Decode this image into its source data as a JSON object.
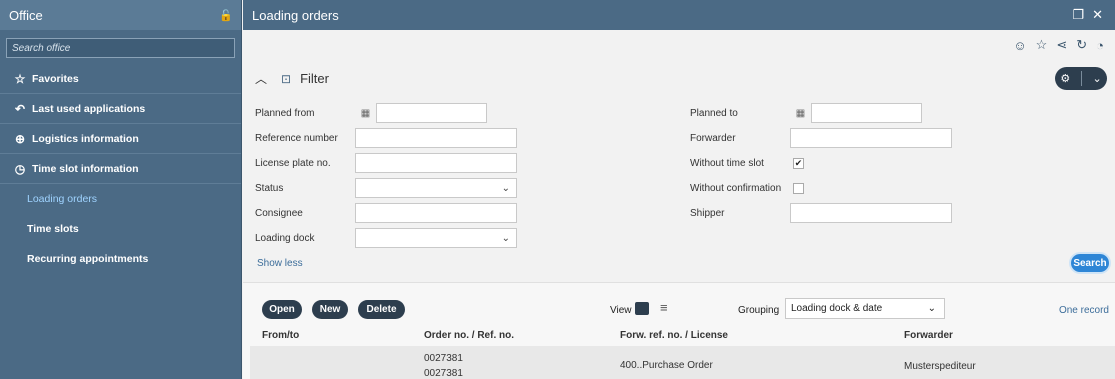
{
  "sidebar": {
    "title": "Office",
    "search_placeholder": "Search office",
    "items": [
      {
        "label": "Favorites"
      },
      {
        "label": "Last used applications"
      },
      {
        "label": "Logistics information"
      },
      {
        "label": "Time slot information"
      }
    ],
    "subitems": [
      {
        "label": "Loading orders",
        "active": true
      },
      {
        "label": "Time slots"
      },
      {
        "label": "Recurring appointments"
      }
    ]
  },
  "window": {
    "title": "Loading orders"
  },
  "filter": {
    "title": "Filter",
    "fields_left": [
      {
        "label": "Planned from",
        "value": ""
      },
      {
        "label": "Reference number",
        "value": ""
      },
      {
        "label": "License plate no.",
        "value": ""
      },
      {
        "label": "Status",
        "value": ""
      },
      {
        "label": "Consignee",
        "value": ""
      },
      {
        "label": "Loading dock",
        "value": ""
      }
    ],
    "fields_right": [
      {
        "label": "Planned to",
        "value": ""
      },
      {
        "label": "Forwarder",
        "value": ""
      },
      {
        "label": "Without time slot",
        "checked": true
      },
      {
        "label": "Without confirmation",
        "checked": false
      },
      {
        "label": "Shipper",
        "value": ""
      }
    ],
    "show_less": "Show less",
    "search_button": "Search"
  },
  "toolbar": {
    "open_label": "Open",
    "new_label": "New",
    "delete_label": "Delete",
    "view_label": "View",
    "grouping_label": "Grouping",
    "grouping_value": "Loading dock & date",
    "record_count": "One record"
  },
  "table": {
    "columns": [
      "From/to",
      "Order no. / Ref. no.",
      "Forw. ref. no. / License",
      "Forwarder"
    ],
    "rows": [
      {
        "from_to": "",
        "order_no": "0027381",
        "ref_no": "0027381",
        "forw_ref": "400..Purchase Order",
        "forwarder": "Musterspediteur"
      }
    ]
  }
}
